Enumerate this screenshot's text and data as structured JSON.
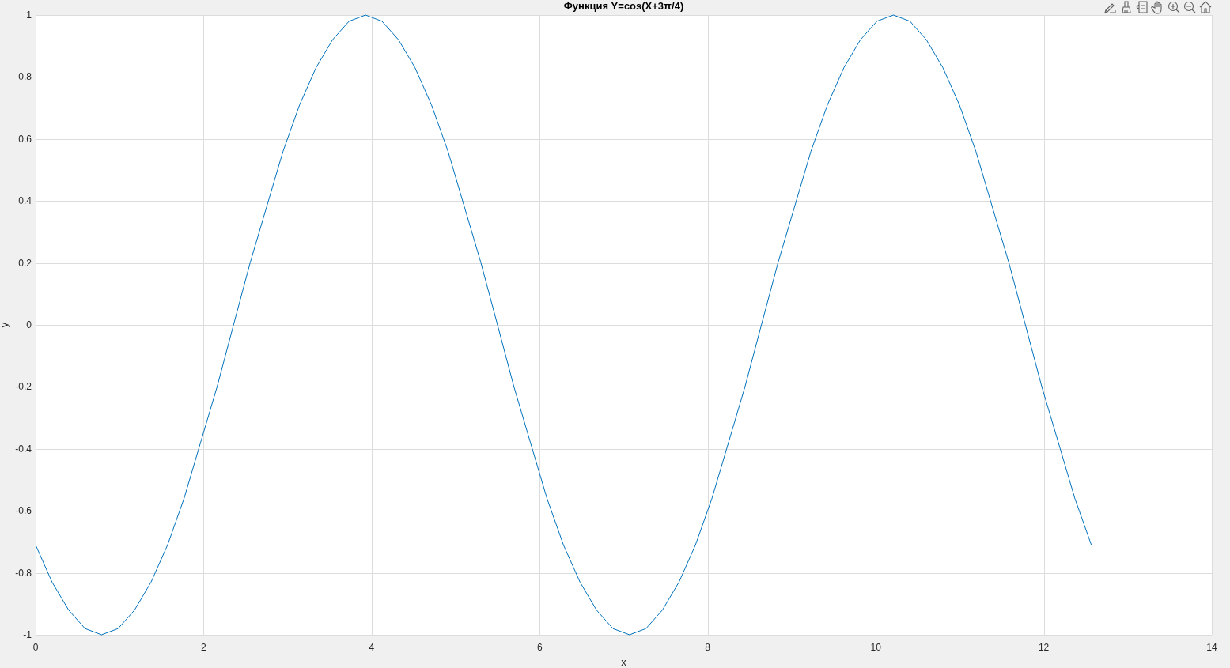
{
  "figure": {
    "toolbar": [
      {
        "kind": "edit"
      },
      {
        "kind": "brush"
      },
      {
        "kind": "legend"
      },
      {
        "kind": "pan"
      },
      {
        "kind": "zoom-in"
      },
      {
        "kind": "zoom-out"
      },
      {
        "kind": "home"
      }
    ],
    "chart_data": {
      "type": "line",
      "title": "Функция Y=cos(X+3π/4)",
      "grid": true,
      "xlabel": "x",
      "ylabel": "y",
      "xlim": [
        0,
        14
      ],
      "ylim": [
        -1,
        1
      ],
      "xticks": [
        0,
        2,
        4,
        6,
        8,
        10,
        12,
        14
      ],
      "yticks": [
        -1,
        -0.8,
        -0.6,
        -0.4,
        -0.2,
        0,
        0.2,
        0.4,
        0.6,
        0.8,
        1
      ],
      "x": [
        0,
        0.196,
        0.393,
        0.589,
        0.785,
        0.982,
        1.178,
        1.374,
        1.571,
        1.767,
        1.963,
        2.16,
        2.356,
        2.553,
        2.749,
        2.945,
        3.142,
        3.338,
        3.534,
        3.731,
        3.927,
        4.123,
        4.32,
        4.516,
        4.712,
        4.909,
        5.105,
        5.301,
        5.498,
        5.694,
        5.89,
        6.087,
        6.283,
        6.48,
        6.676,
        6.872,
        7.069,
        7.265,
        7.461,
        7.658,
        7.854,
        8.05,
        8.247,
        8.443,
        8.639,
        8.836,
        9.032,
        9.228,
        9.425,
        9.621,
        9.817,
        10.014,
        10.21,
        10.407,
        10.603,
        10.799,
        10.996,
        11.192,
        11.388,
        11.585,
        11.781,
        11.977,
        12.174,
        12.37,
        12.566
      ],
      "series": [
        {
          "color": "#0072bd",
          "values": [
            -0.71,
            -0.83,
            -0.92,
            -0.98,
            -1,
            -0.98,
            -0.92,
            -0.83,
            -0.71,
            -0.56,
            -0.38,
            -0.2,
            0,
            0.2,
            0.38,
            0.56,
            0.71,
            0.83,
            0.92,
            0.98,
            1,
            0.98,
            0.92,
            0.83,
            0.71,
            0.56,
            0.38,
            0.2,
            0,
            -0.2,
            -0.38,
            -0.56,
            -0.71,
            -0.83,
            -0.92,
            -0.98,
            -1,
            -0.98,
            -0.92,
            -0.83,
            -0.71,
            -0.56,
            -0.38,
            -0.2,
            0,
            0.2,
            0.38,
            0.56,
            0.71,
            0.83,
            0.92,
            0.98,
            1,
            0.98,
            0.92,
            0.83,
            0.71,
            0.56,
            0.38,
            0.2,
            0,
            -0.2,
            -0.38,
            -0.56,
            -0.71
          ]
        }
      ]
    }
  }
}
